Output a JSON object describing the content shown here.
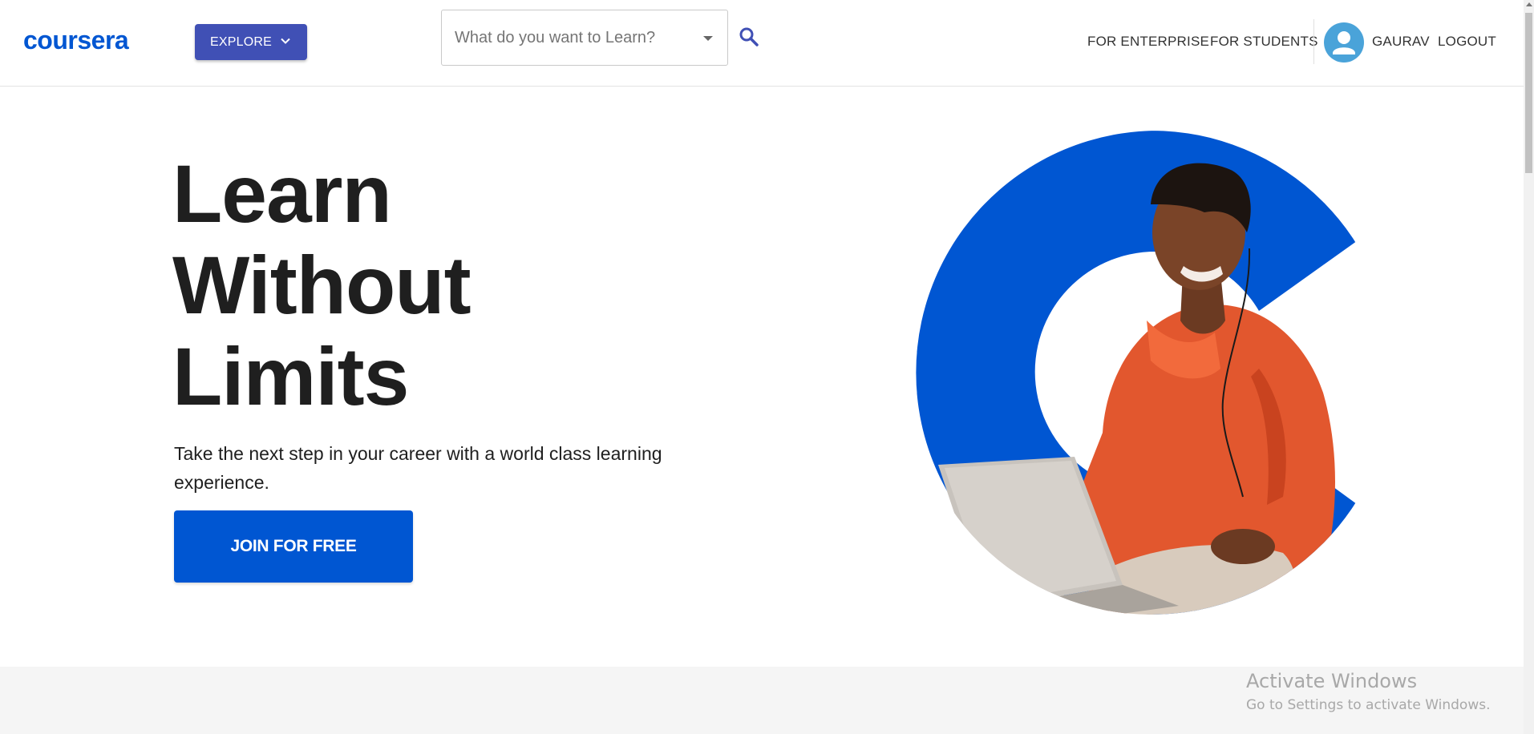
{
  "header": {
    "logo": "coursera",
    "explore_label": "EXPLORE",
    "search": {
      "placeholder": "What do you want to Learn?"
    },
    "nav": {
      "enterprise": "FOR ENTERPRISE",
      "students": "FOR STUDENTS",
      "user": "GAURAV",
      "logout": "LOGOUT"
    }
  },
  "hero": {
    "title_lines": [
      "Learn",
      "Without",
      "Limits"
    ],
    "subtitle": "Take the next step in your career with a world class learning experience.",
    "cta": "JOIN FOR FREE"
  },
  "watermark": {
    "title": "Activate Windows",
    "subtitle": "Go to Settings to activate Windows."
  },
  "colors": {
    "brand_blue": "#0056d2",
    "explore_indigo": "#4050b5",
    "avatar": "#4aa3d9"
  },
  "icons": [
    "chevron-down-icon",
    "dropdown-caret-icon",
    "search-icon",
    "user-avatar-icon"
  ]
}
